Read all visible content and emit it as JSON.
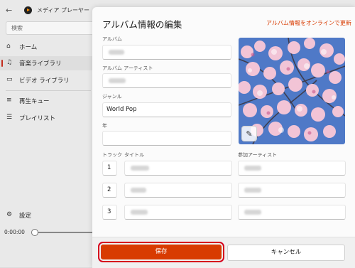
{
  "app": {
    "title": "メディア プレーヤー",
    "search_placeholder": "検索",
    "nav": [
      {
        "label": "ホーム",
        "icon": "home-icon"
      },
      {
        "label": "音楽ライブラリ",
        "icon": "music-icon",
        "active": true
      },
      {
        "label": "ビデオ ライブラリ",
        "icon": "video-icon"
      },
      {
        "label": "再生キュー",
        "icon": "queue-icon"
      },
      {
        "label": "プレイリスト",
        "icon": "playlist-icon"
      }
    ],
    "settings_label": "設定",
    "time": "0:00:00",
    "accent": "#c42b1c"
  },
  "dialog": {
    "title": "アルバム情報の編集",
    "online_update_link": "アルバム情報をオンラインで更新",
    "album_label": "アルバム",
    "album_artist_label": "アルバム アーティスト",
    "genre_label": "ジャンル",
    "genre_value": "World Pop",
    "year_label": "年",
    "year_value": "",
    "track_label": "トラック",
    "title_label": "タイトル",
    "contributing_artist_label": "参加アーティスト",
    "tracks": [
      {
        "number": "1"
      },
      {
        "number": "2"
      },
      {
        "number": "3"
      }
    ],
    "save_label": "保存",
    "cancel_label": "キャンセル",
    "save_color": "#d83b01",
    "link_color": "#d83b01"
  }
}
